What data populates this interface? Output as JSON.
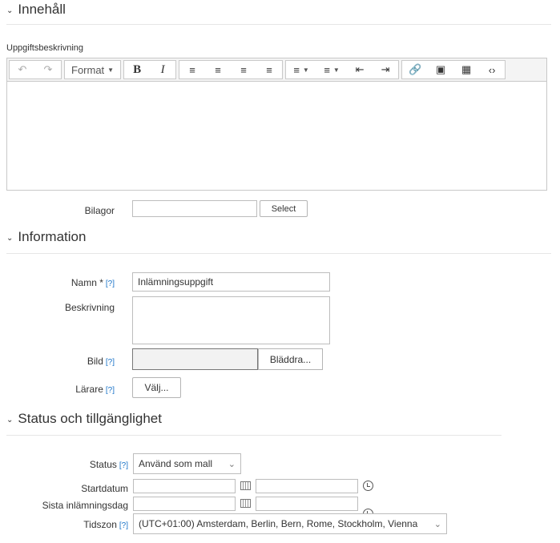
{
  "sections": {
    "content": "Innehåll",
    "information": "Information",
    "status": "Status och tillgänglighet"
  },
  "editor": {
    "label": "Uppgiftsbeskrivning",
    "format_label": "Format",
    "tools": [
      "undo-icon",
      "redo-icon",
      "bold-icon",
      "italic-icon",
      "align-left-icon",
      "align-center-icon",
      "align-right-icon",
      "align-justify-icon",
      "bullet-list-icon",
      "numbered-list-icon",
      "outdent-icon",
      "indent-icon",
      "link-icon",
      "image-icon",
      "media-icon",
      "code-icon"
    ]
  },
  "attachments": {
    "label": "Bilagor",
    "select_label": "Select"
  },
  "info": {
    "name_label": "Namn *",
    "name_help": "[?]",
    "name_value": "Inlämningsuppgift",
    "desc_label": "Beskrivning",
    "image_label": "Bild",
    "image_help": "[?]",
    "browse_label": "Bläddra...",
    "teacher_label": "Lärare",
    "teacher_help": "[?]",
    "choose_label": "Välj..."
  },
  "status": {
    "status_label": "Status",
    "status_help": "[?]",
    "status_value": "Använd som mall",
    "start_label": "Startdatum",
    "due_label": "Sista inlämningsdag",
    "tz_label": "Tidszon",
    "tz_help": "[?]",
    "tz_value": "(UTC+01:00) Amsterdam, Berlin, Bern, Rome, Stockholm, Vienna"
  }
}
